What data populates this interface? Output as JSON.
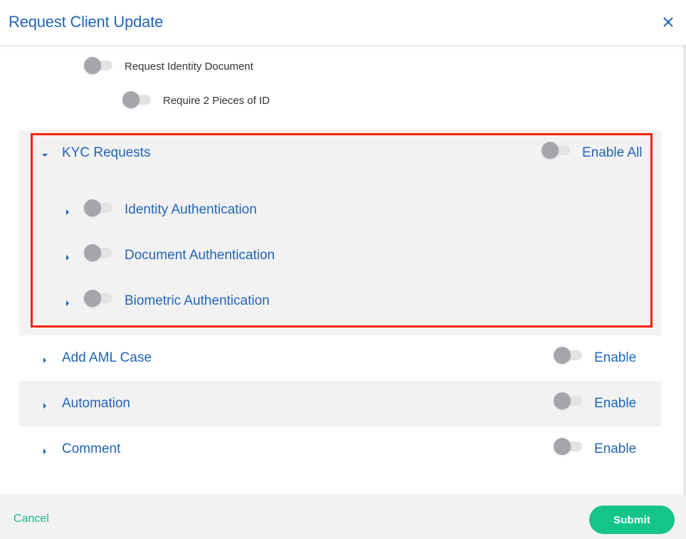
{
  "dialog": {
    "title": "Request Client Update"
  },
  "identity_options": {
    "request_identity_document": "Request Identity Document",
    "require_two_ids": "Require 2 Pieces of ID"
  },
  "kyc": {
    "title": "KYC Requests",
    "enable_all_label": "Enable All",
    "items": [
      {
        "label": "Identity Authentication"
      },
      {
        "label": "Document Authentication"
      },
      {
        "label": "Biometric Authentication"
      }
    ]
  },
  "sections": [
    {
      "label": "Add AML Case",
      "enable_label": "Enable"
    },
    {
      "label": "Automation",
      "enable_label": "Enable"
    },
    {
      "label": "Comment",
      "enable_label": "Enable"
    }
  ],
  "footer": {
    "cancel_label": "Cancel",
    "submit_label": "Submit"
  },
  "colors": {
    "accent_blue": "#2266b8",
    "submit_green": "#14c48b",
    "cancel_green": "#18b983",
    "highlight_red": "#f5230f",
    "toggle_off_knob": "#a4a6ab",
    "section_grey": "#f2f2f3"
  },
  "icons": {
    "close": "close-icon",
    "caret_down": "caret-down-icon",
    "caret_right": "caret-right-icon"
  }
}
